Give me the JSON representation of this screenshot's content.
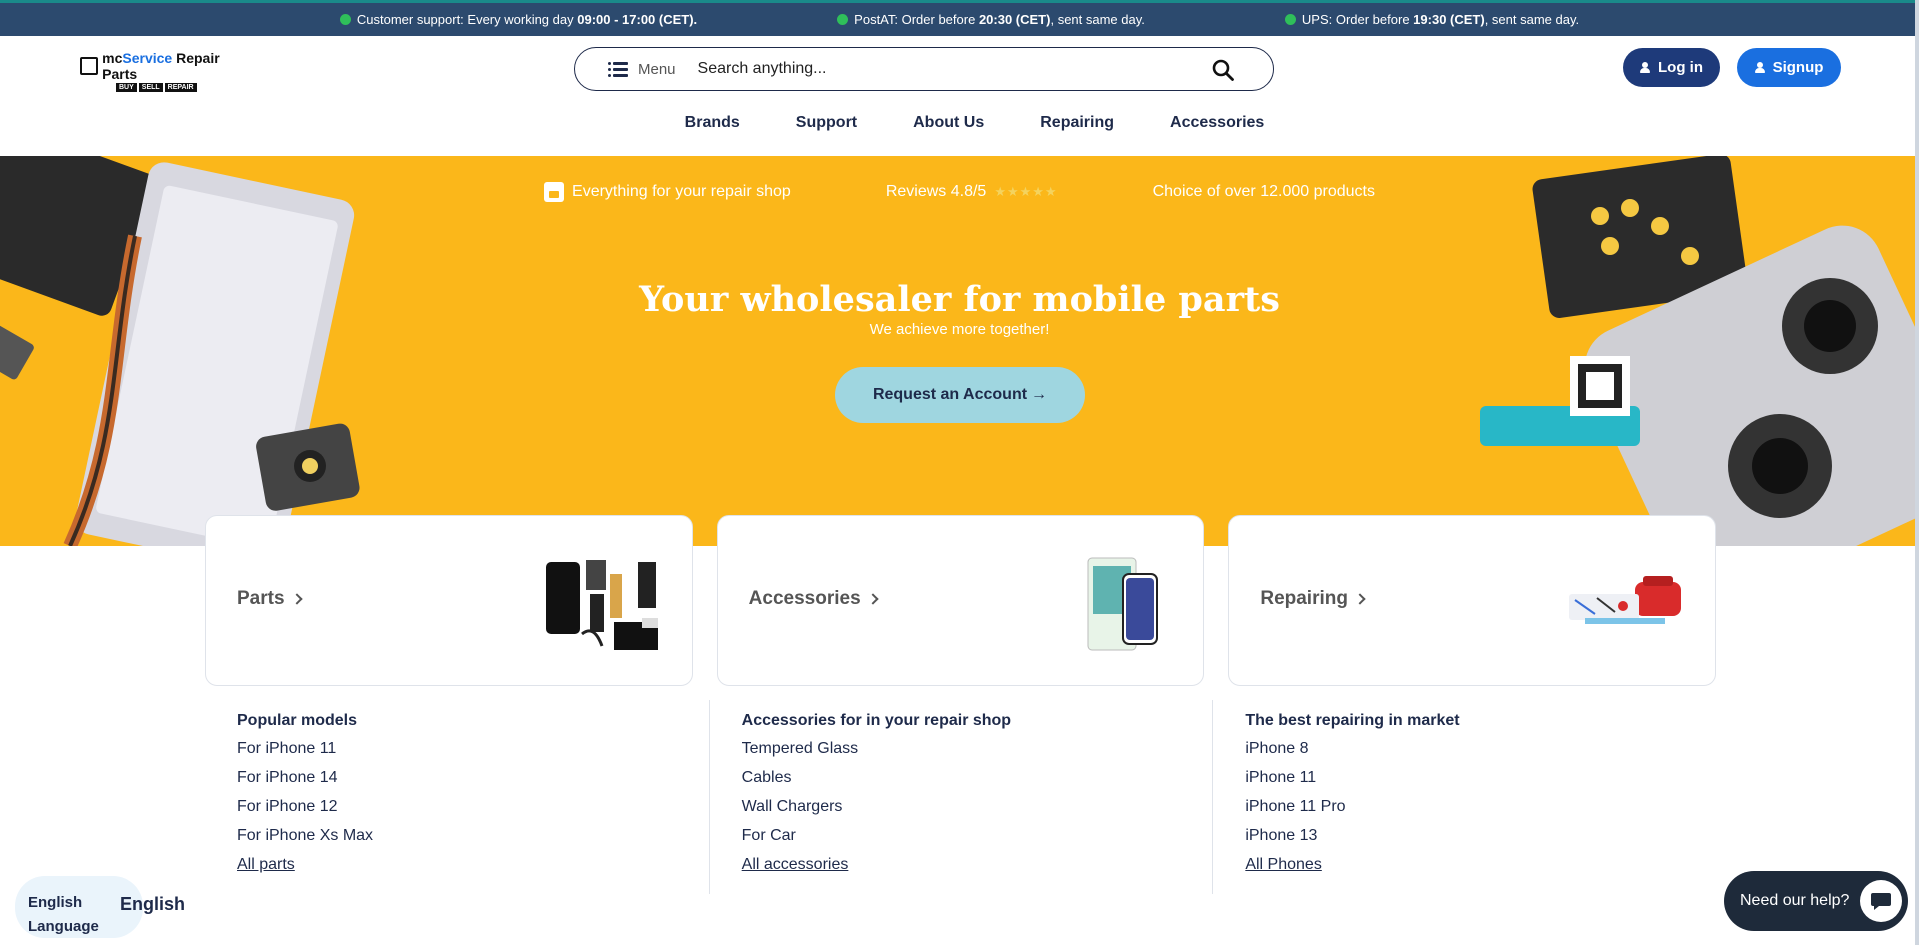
{
  "topbar": [
    {
      "prefix": "Customer support: Every working day ",
      "bold": "09:00 - 17:00 (CET).",
      "suffix": ""
    },
    {
      "prefix": "PostAT: Order before ",
      "bold": "20:30 (CET)",
      "suffix": ", sent same day."
    },
    {
      "prefix": "UPS: Order before ",
      "bold": "19:30 (CET)",
      "suffix": ", sent same day."
    }
  ],
  "header": {
    "logo": {
      "name_a": "mc",
      "name_b": "Service",
      "name_c": " Repair Parts",
      "tags": [
        "BUY",
        "SELL",
        "REPAIR"
      ]
    },
    "menu_label": "Menu",
    "search_placeholder": "Search anything...",
    "login_label": "Log in",
    "signup_label": "Signup"
  },
  "nav": [
    "Brands",
    "Support",
    "About Us",
    "Repairing",
    "Accessories"
  ],
  "hero": {
    "usps": [
      "Everything for your repair shop",
      "Reviews 4.8/5",
      "Choice of over 12.000 products"
    ],
    "stars": "★★★★★",
    "title": "Your wholesaler for mobile parts",
    "subtitle": "We achieve more together!",
    "cta": "Request an Account",
    "cta_arrow": "→"
  },
  "cards": [
    {
      "title": "Parts",
      "icon": "phone-parts-image"
    },
    {
      "title": "Accessories",
      "icon": "screen-protector-image"
    },
    {
      "title": "Repairing",
      "icon": "repair-kit-image"
    }
  ],
  "columns": [
    {
      "title": "Popular models",
      "links": [
        "For iPhone 11",
        "For iPhone 14",
        "For iPhone 12",
        "For iPhone Xs Max"
      ],
      "all": "All parts"
    },
    {
      "title": "Accessories for in your repair shop",
      "links": [
        "Tempered Glass",
        "Cables",
        "Wall Chargers",
        "For Car"
      ],
      "all": "All accessories"
    },
    {
      "title": "The best repairing in market",
      "links": [
        "iPhone 8",
        "iPhone 11",
        "iPhone 11 Pro",
        "iPhone 13"
      ],
      "all": "All Phones"
    }
  ],
  "language": {
    "line1": "English",
    "line2": "Language",
    "current": "English"
  },
  "chat": {
    "label": "Need our help?"
  },
  "colors": {
    "topbar": "#2c4a6e",
    "hero": "#fbb71a",
    "navy": "#1e3a7a",
    "blue": "#1a6fe0",
    "cta": "#9fd6e0"
  }
}
